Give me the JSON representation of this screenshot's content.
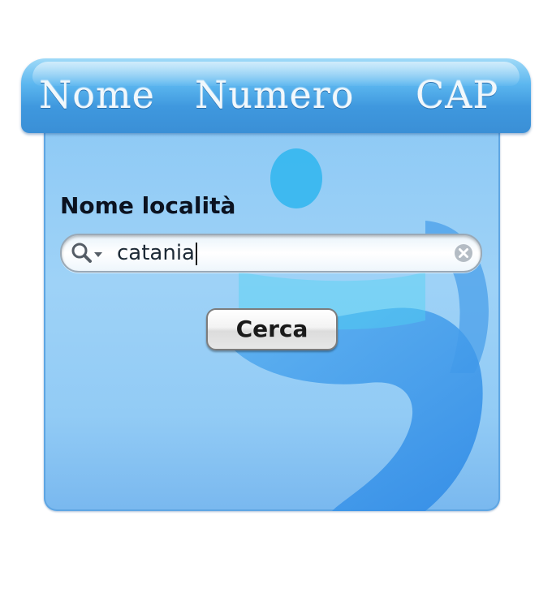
{
  "tabs": [
    {
      "label": "Nome"
    },
    {
      "label": "Numero"
    },
    {
      "label": "CAP"
    }
  ],
  "form": {
    "field_label": "Nome località",
    "search_value": "catania",
    "search_icon": "magnifier-with-dropdown-icon",
    "clear_icon": "clear-x-icon",
    "submit_label": "Cerca"
  },
  "colors": {
    "tab_bar": "#4aa6e6",
    "panel": "#95cdf6",
    "logo_blue": "#3d9bea",
    "logo_cyan": "#3fd0f0"
  }
}
